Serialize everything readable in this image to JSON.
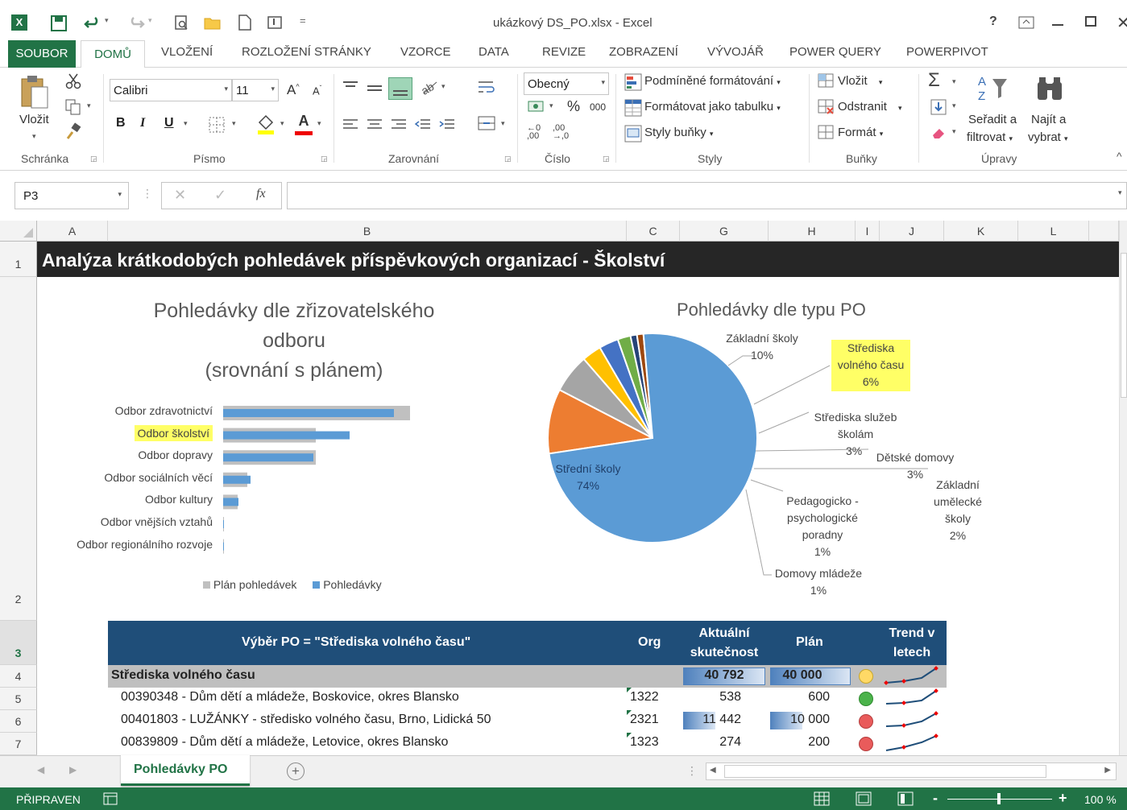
{
  "window": {
    "title": "ukázkový DS_PO.xlsx - Excel",
    "help": "?"
  },
  "tabs": [
    "SOUBOR",
    "DOMŮ",
    "VLOŽENÍ",
    "ROZLOŽENÍ STRÁNKY",
    "VZORCE",
    "DATA",
    "REVIZE",
    "ZOBRAZENÍ",
    "VÝVOJÁŘ",
    "POWER QUERY",
    "POWERPIVOT"
  ],
  "ribbon": {
    "paste": "Vložit",
    "font_name": "Calibri",
    "font_size": "11",
    "number_format": "Obecný",
    "percent": "%",
    "thousands": "000",
    "cond_format": "Podmíněné formátování",
    "format_table": "Formátovat jako tabulku",
    "cell_styles": "Styly buňky",
    "insert": "Vložit",
    "delete": "Odstranit",
    "format": "Formát",
    "sort1": "Seřadit a",
    "sort2": "filtrovat",
    "find1": "Najít a",
    "find2": "vybrat",
    "groups": {
      "clipboard": "Schránka",
      "font": "Písmo",
      "alignment": "Zarovnání",
      "number": "Číslo",
      "styles": "Styly",
      "cells": "Buňky",
      "editing": "Úpravy"
    }
  },
  "formula": {
    "name_box": "P3",
    "fx": "fx",
    "value": ""
  },
  "columns": [
    "A",
    "B",
    "C",
    "G",
    "H",
    "I",
    "J",
    "K",
    "L"
  ],
  "rows": [
    "1",
    "2",
    "3",
    "4",
    "5",
    "6",
    "7"
  ],
  "sheet": {
    "banner": "Analýza krátkodobých pohledávek příspěvkových organizací - Školství",
    "table_header": {
      "selection": "Výběr PO = \"Střediska volného času\"",
      "org": "Org",
      "actual1": "Aktuální",
      "actual2": "skutečnost",
      "plan": "Plán",
      "trend1": "Trend v",
      "trend2": "letech"
    },
    "group_row": {
      "name": "Střediska volného času",
      "actual": "40 792",
      "plan": "40 000",
      "status_color": "#ffd966"
    },
    "rows": [
      {
        "name": "00390348 - Dům dětí a mládeže, Boskovice, okres Blansko",
        "org": "1322",
        "actual": "538",
        "plan": "600",
        "status_color": "#4bb34b"
      },
      {
        "name": "00401803 - LUŽÁNKY - středisko volného času, Brno, Lidická 50",
        "org": "2321",
        "actual": "11 442",
        "plan": "10 000",
        "status_color": "#e95b5b"
      },
      {
        "name": "00839809 - Dům dětí a mládeže, Letovice, okres Blansko",
        "org": "1323",
        "actual": "274",
        "plan": "200",
        "status_color": "#e95b5b"
      }
    ]
  },
  "chart_data": [
    {
      "type": "bar",
      "title": "Pohledávky dle zřizovatelského odboru (srovnání s plánem)",
      "title_lines": [
        "Pohledávky dle zřizovatelského",
        "odboru",
        "(srovnání s plánem)"
      ],
      "categories": [
        "Odbor zdravotnictví",
        "Odbor školství",
        "Odbor dopravy",
        "Odbor sociálních věcí",
        "Odbor kultury",
        "Odbor vnějších vztahů",
        "Odbor regionálního rozvoje"
      ],
      "highlighted_category": "Odbor školství",
      "series": [
        {
          "name": "Plán pohledávek",
          "color": "#c0c0c0",
          "values": [
            232,
            115,
            115,
            30,
            18,
            1,
            1
          ]
        },
        {
          "name": "Pohledávky",
          "color": "#5b9bd5",
          "values": [
            212,
            157,
            112,
            34,
            19,
            1,
            1
          ]
        }
      ],
      "legend": "bottom"
    },
    {
      "type": "pie",
      "title": "Pohledávky dle typu PO",
      "slices": [
        {
          "label": "Střední školy",
          "pct_label": "74%",
          "value": 74,
          "color": "#5b9bd5"
        },
        {
          "label": "Základní školy",
          "pct_label": "10%",
          "value": 10,
          "color": "#ed7d31"
        },
        {
          "label": "Střediska volného času",
          "pct_label": "6%",
          "value": 6,
          "color": "#a5a5a5"
        },
        {
          "label": "Střediska služeb školám",
          "pct_label": "3%",
          "value": 3,
          "color": "#ffc000"
        },
        {
          "label": "Dětské domovy",
          "pct_label": "3%",
          "value": 3,
          "color": "#4472c4"
        },
        {
          "label": "Základní umělecké školy",
          "pct_label": "2%",
          "value": 2,
          "color": "#70ad47"
        },
        {
          "label": "Pedagogicko - psychologické poradny",
          "pct_label": "1%",
          "value": 1,
          "color": "#264478"
        },
        {
          "label": "Domovy mládeže",
          "pct_label": "1%",
          "value": 1,
          "color": "#9e480e"
        }
      ],
      "highlighted_slice": "Střediska volného času",
      "label_lines": {
        "zs": [
          "Základní školy",
          "10%"
        ],
        "svc": [
          "Střediska",
          "volného času",
          "6%"
        ],
        "sss": [
          "Střediska služeb",
          "školám",
          "3%"
        ],
        "dd": [
          "Dětské domovy",
          "3%"
        ],
        "zus": [
          "Základní",
          "umělecké",
          "školy",
          "2%"
        ],
        "ppp": [
          "Pedagogicko -",
          "psychologické",
          "poradny",
          "1%"
        ],
        "dm": [
          "Domovy mládeže",
          "1%"
        ],
        "ss": [
          "Střední školy",
          "74%"
        ]
      }
    }
  ],
  "sheet_tab": "Pohledávky PO",
  "status": {
    "ready": "PŘIPRAVEN",
    "zoom": "100 %"
  },
  "colors": {
    "excel_green": "#217346",
    "header_blue": "#1f4e79",
    "banner": "#222222",
    "highlight": "#ffff66"
  }
}
